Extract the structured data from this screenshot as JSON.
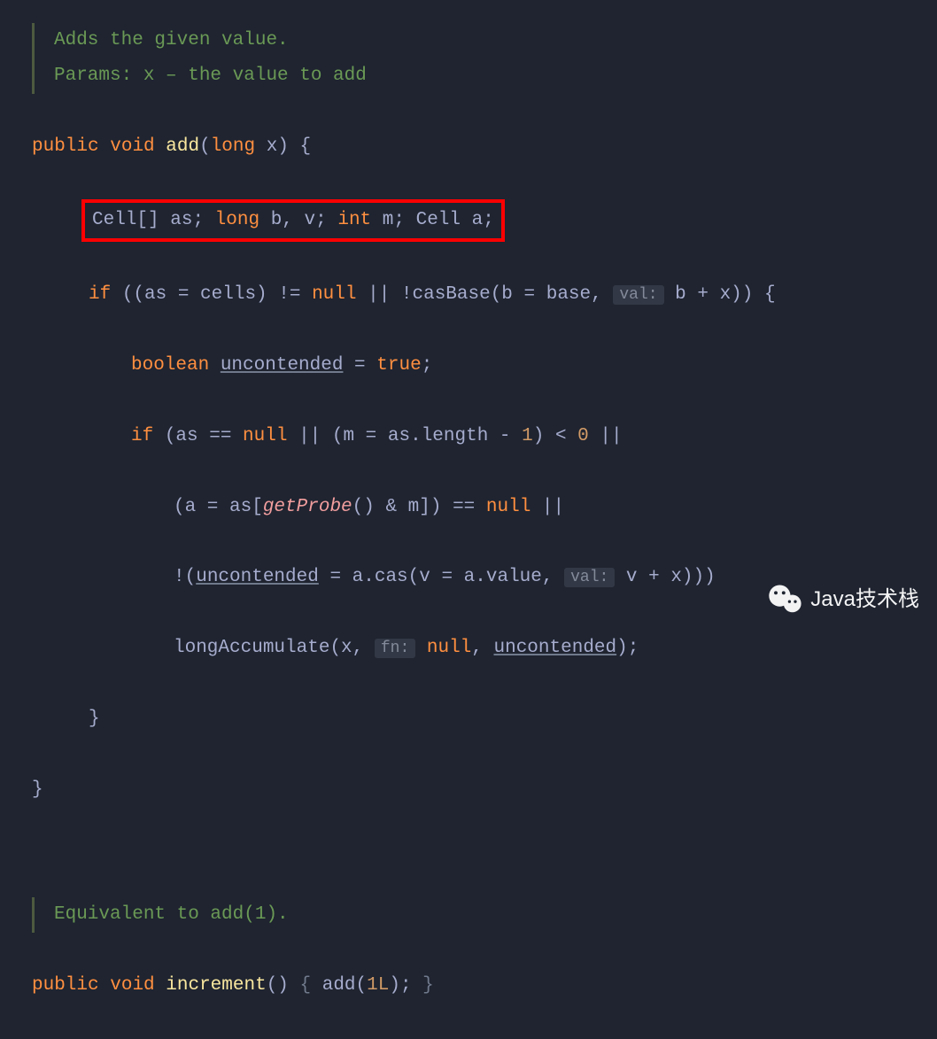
{
  "doc1_line1": "Adds the given value.",
  "doc1_line2": "Params: x – the value to add",
  "sig1": {
    "public": "public",
    "void": "void",
    "name": "add",
    "long": "long",
    "param": "x"
  },
  "decl": {
    "cell": "Cell",
    "arr": "[] ",
    "as": "as",
    "sc1": "; ",
    "long": "long ",
    "b": "b",
    "c1": ", ",
    "v": "v",
    "sc2": "; ",
    "int": "int ",
    "m": "m",
    "sc3": "; ",
    "cell2": "Cell ",
    "a": "a",
    "sc4": ";"
  },
  "if1": {
    "if": "if",
    "open": " ((as = cells) != ",
    "null": "null",
    " mid": " || !casBase(b = base, ",
    "hint": "val:",
    "tail": " b + x)) {"
  },
  "uncont_decl": {
    "boolean": "boolean",
    "name": "uncontended",
    "eq": " = ",
    "true": "true",
    "sc": ";"
  },
  "if2": {
    "if": "if",
    "p1": " (as == ",
    "null1": "null",
    "p2": " || (m = as.length - ",
    "one": "1",
    "p3": ") < ",
    "zero": "0",
    "p4": " ||"
  },
  "if2b": {
    "p1": "(a = as[",
    "probe": "getProbe",
    "p2": "() & m]) == ",
    "null": "null",
    "p3": " ||"
  },
  "if2c": {
    "bang": "!(",
    "u": "uncontended",
    "eq": " = a.cas(v = a.value, ",
    "hint": "val:",
    "tail": " v + x)))"
  },
  "acc": {
    "fn": "longAccumulate",
    "p1": "(x, ",
    "hint": "fn:",
    "null": " null",
    "c": ", ",
    "u": "uncontended",
    "p2": ");"
  },
  "closeb": "}",
  "closeb2": "}",
  "doc2": "Equivalent to add(1).",
  "sig2": {
    "public": "public",
    "void": "void",
    "name": "increment",
    "body_open": "() ",
    "brace_l": "{",
    "call": " add(",
    "arg": "1L",
    "call2": "); ",
    "brace_r": "}"
  },
  "watermark": "Java技术栈"
}
